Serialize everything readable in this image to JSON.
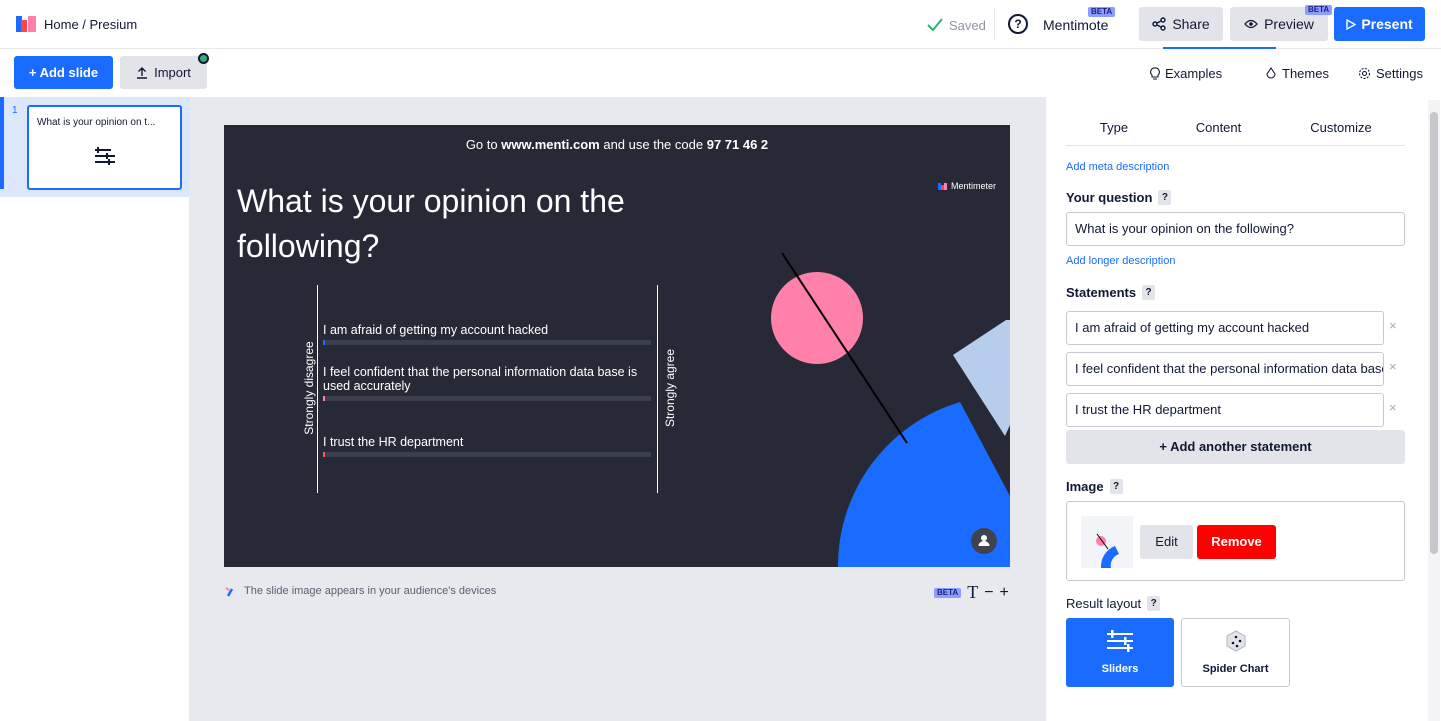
{
  "header": {
    "breadcrumb": "Home / Presium",
    "saved_label": "Saved",
    "help_label": "?",
    "mentimote_label": "Mentimote",
    "mentimote_badge": "BETA",
    "share_label": "Share",
    "preview_label": "Preview",
    "preview_badge": "BETA",
    "present_label": "Present"
  },
  "toolbar": {
    "add_slide_label": "+ Add slide",
    "import_label": "Import",
    "examples_label": "Examples",
    "themes_label": "Themes",
    "settings_label": "Settings"
  },
  "slides": [
    {
      "number": "1",
      "title": "What is your opinion on t..."
    }
  ],
  "slide": {
    "instruction_prefix": "Go to",
    "instruction_url": "www.menti.com",
    "instruction_mid": "and use the code",
    "instruction_code": "97 71 46 2",
    "brand": "Mentimeter",
    "question": "What is your opinion on the following?",
    "left_label": "Strongly disagree",
    "right_label": "Strongly agree",
    "statements": [
      {
        "text": "I am afraid of getting my account hacked",
        "color": "#196cff"
      },
      {
        "text": "I feel confident that the personal information data base is used accurately",
        "color": "#ff80ab"
      },
      {
        "text": "I trust the HR department",
        "color": "#ff5a5a"
      }
    ]
  },
  "canvas": {
    "caption": "The slide image appears in your audience's devices",
    "zoom_badge": "BETA",
    "zoom_font": "T",
    "zoom_minus": "−",
    "zoom_plus": "+"
  },
  "editor": {
    "tabs": [
      "Type",
      "Content",
      "Customize"
    ],
    "active_tab": "Content",
    "add_meta": "Add meta description",
    "question_label": "Your question",
    "question_value": "What is your opinion on the following?",
    "add_longer": "Add longer description",
    "statements_label": "Statements",
    "statement_values": [
      "I am afraid of getting my account hacked",
      "I feel confident that the personal information data base is used accurately",
      "I trust the HR department"
    ],
    "add_statement": "+ Add another statement",
    "image_label": "Image",
    "edit_label": "Edit",
    "remove_label": "Remove",
    "result_layout_label": "Result layout",
    "layout_options": [
      "Sliders",
      "Spider Chart"
    ],
    "selected_layout": "Sliders",
    "help_mark": "?",
    "remove_x": "×"
  },
  "colors": {
    "accent": "#196cff",
    "danger": "#ff0000",
    "slide_bg": "#272a36",
    "pink": "#ff80ab",
    "light_blue": "#b6cdeb"
  }
}
